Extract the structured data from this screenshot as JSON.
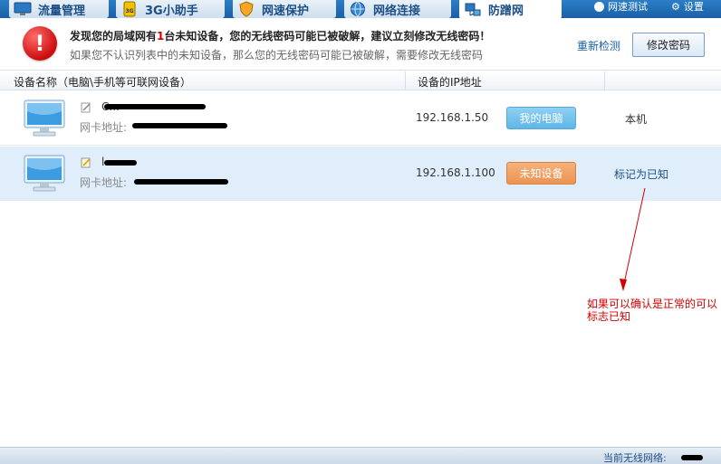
{
  "tabs": [
    {
      "label": "流量管理",
      "icon": "monitor-icon"
    },
    {
      "label": "3G小助手",
      "icon": "3g-icon"
    },
    {
      "label": "网速保护",
      "icon": "shield-icon"
    },
    {
      "label": "网络连接",
      "icon": "globe-icon"
    },
    {
      "label": "防蹭网",
      "icon": "network-icon",
      "active": true
    }
  ],
  "topright": {
    "speedtest": "网速测试",
    "settings": "设置"
  },
  "alert": {
    "title_prefix": "发现您的局域网有",
    "title_count": "1",
    "title_suffix": "台未知设备，您的无线密码可能已被破解，建议立刻修改无线密码！",
    "subtitle": "如果您不认识列表中的未知设备，那么您的无线密码可能已被破解，需要修改无线密码",
    "recheck_label": "重新检测",
    "change_password_label": "修改密码"
  },
  "table": {
    "columns": [
      "设备名称（电脑\\手机等可联网设备）",
      "设备的IP地址"
    ],
    "rows": [
      {
        "name": "C...",
        "mac_label": "网卡地址:",
        "ip": "192.168.1.50",
        "badge": "我的电脑",
        "status": "本机"
      },
      {
        "name": "l...",
        "mac_label": "网卡地址:",
        "ip": "192.168.1.100",
        "badge": "未知设备",
        "status": "标记为已知"
      }
    ]
  },
  "annotation": {
    "text": "如果可以确认是正常的可以标志已知"
  },
  "statusbar": {
    "current_network_label": "当前无线网络:"
  },
  "colors": {
    "accent": "#1a5fa6",
    "alert_red": "#d40000",
    "selected_row": "#dfeefa",
    "badge_mine": "#5eb6e8",
    "badge_unknown": "#eb9352"
  }
}
